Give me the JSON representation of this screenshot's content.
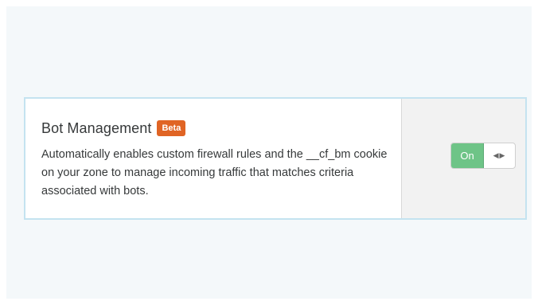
{
  "feature": {
    "title": "Bot Management",
    "badge": "Beta",
    "description": "Automatically enables custom firewall rules and the __cf_bm cookie on your zone to manage incoming traffic that matches criteria associated with bots."
  },
  "toggle": {
    "state_label": "On",
    "is_on": true,
    "handle_icon": "drag-arrows-icon"
  },
  "colors": {
    "badge": "#e06424",
    "toggle_on": "#6ec487",
    "card_border": "#c4e3f0"
  }
}
